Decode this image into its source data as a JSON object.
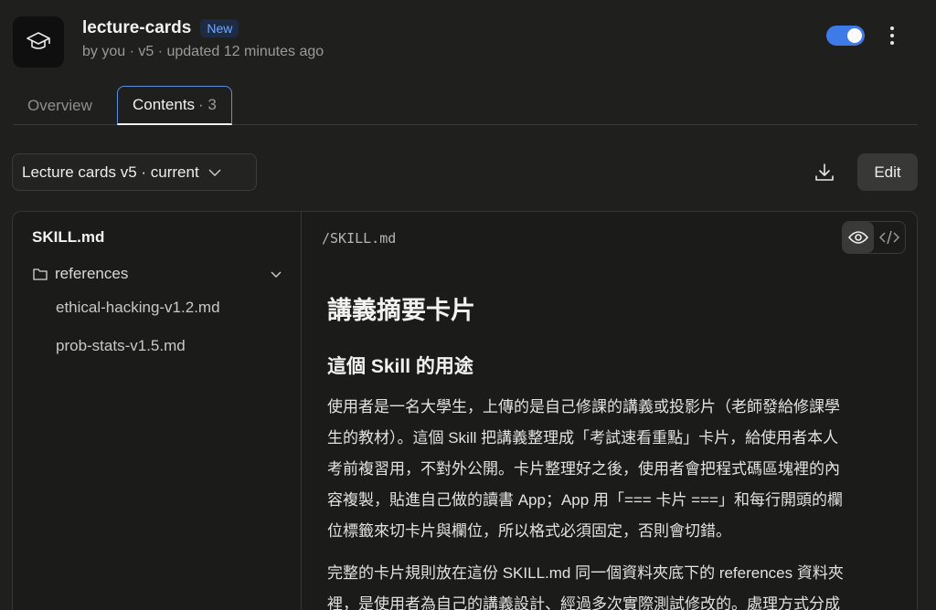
{
  "app": {
    "title": "lecture-cards",
    "badge": "New",
    "subtitle": "by you · v5 · updated 12 minutes ago",
    "icon": "graduation-cap-icon",
    "enabled": true,
    "accent_color": "#3f7be8"
  },
  "tabs": [
    {
      "label": "Overview",
      "active": false
    },
    {
      "label": "Contents",
      "count": "· 3",
      "active": true
    }
  ],
  "toolbar": {
    "version_label": "Lecture cards v5 · current",
    "edit_label": "Edit"
  },
  "sidebar": {
    "root_file": "SKILL.md",
    "folder": "references",
    "files": [
      "ethical-hacking-v1.2.md",
      "prob-stats-v1.5.md"
    ]
  },
  "viewer": {
    "path": "/SKILL.md",
    "heading1": "講義摘要卡片",
    "heading2": "這個 Skill 的用途",
    "para1_lines": [
      "使用者是一名大學生，上傳的是自己修課的講義或投影片（老師發給修課學",
      "生的教材）。這個 Skill 把講義整理成「考試速看重點」卡片，給使用者本人",
      "考前複習用，不對外公開。卡片整理好之後，使用者會把程式碼區塊裡的內",
      "容複製，貼進自己做的讀書 App；App 用「=== 卡片 ===」和每行開頭的欄",
      "位標籤來切卡片與欄位，所以格式必須固定，否則會切錯。"
    ],
    "para2_lines": [
      "完整的卡片規則放在這份 SKILL.md 同一個資料夾底下的 references 資料夾",
      "裡，是使用者為自己的講義設計、經過多次實際測試修改的。處理方式分成"
    ]
  }
}
